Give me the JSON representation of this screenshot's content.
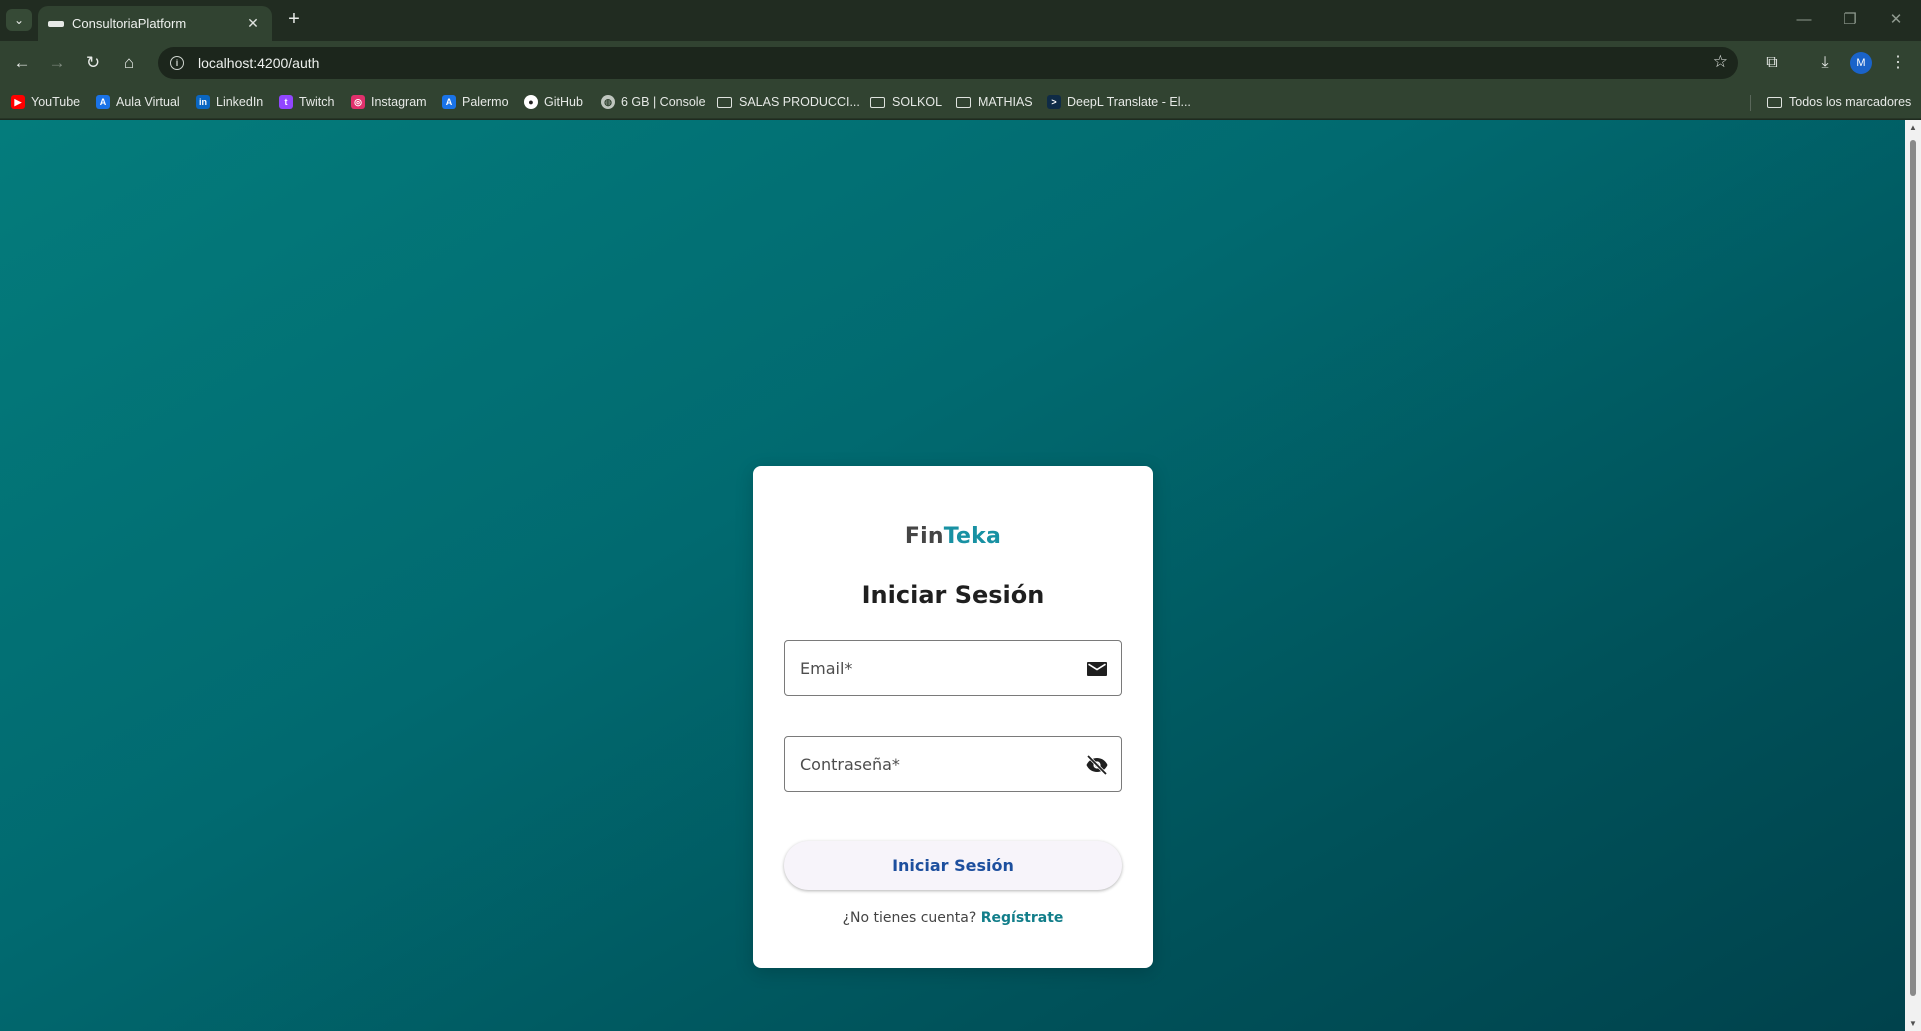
{
  "browser": {
    "tab_title": "ConsultoriaPlatform",
    "url": "localhost:4200/auth",
    "profile_initial": "M",
    "bookmarks": [
      {
        "label": "YouTube",
        "icon": "youtube-icon",
        "color": "#ff0000"
      },
      {
        "label": "Aula Virtual",
        "icon": "aula-virtual-icon",
        "color": "#1a73e8"
      },
      {
        "label": "LinkedIn",
        "icon": "linkedin-icon",
        "color": "#0a66c2"
      },
      {
        "label": "Twitch",
        "icon": "twitch-icon",
        "color": "#9146ff"
      },
      {
        "label": "Instagram",
        "icon": "instagram-icon",
        "color": "#e1306c"
      },
      {
        "label": "Palermo",
        "icon": "palermo-icon",
        "color": "#1a73e8"
      },
      {
        "label": "GitHub",
        "icon": "github-icon",
        "color": "#ffffff"
      },
      {
        "label": "6 GB | Console",
        "icon": "globe-icon",
        "color": "#cccccc"
      },
      {
        "label": "SALAS PRODUCCI...",
        "icon": "folder-icon"
      },
      {
        "label": "SOLKOL",
        "icon": "folder-icon"
      },
      {
        "label": "MATHIAS",
        "icon": "folder-icon"
      },
      {
        "label": "DeepL Translate - El...",
        "icon": "deepl-icon",
        "color": "#0f2b46"
      }
    ],
    "all_bookmarks_label": "Todos los marcadores"
  },
  "login": {
    "logo_part1": "Fin",
    "logo_part2": "Teka",
    "title": "Iniciar Sesión",
    "email_label": "Email*",
    "password_label": "Contraseña*",
    "submit_label": "Iniciar Sesión",
    "no_account_text": "¿No tienes cuenta?",
    "register_link": "Regístrate"
  },
  "colors": {
    "accent": "#1891a3",
    "button_text": "#1d4f9e",
    "background_start": "#047c7c",
    "background_end": "#00424c"
  }
}
